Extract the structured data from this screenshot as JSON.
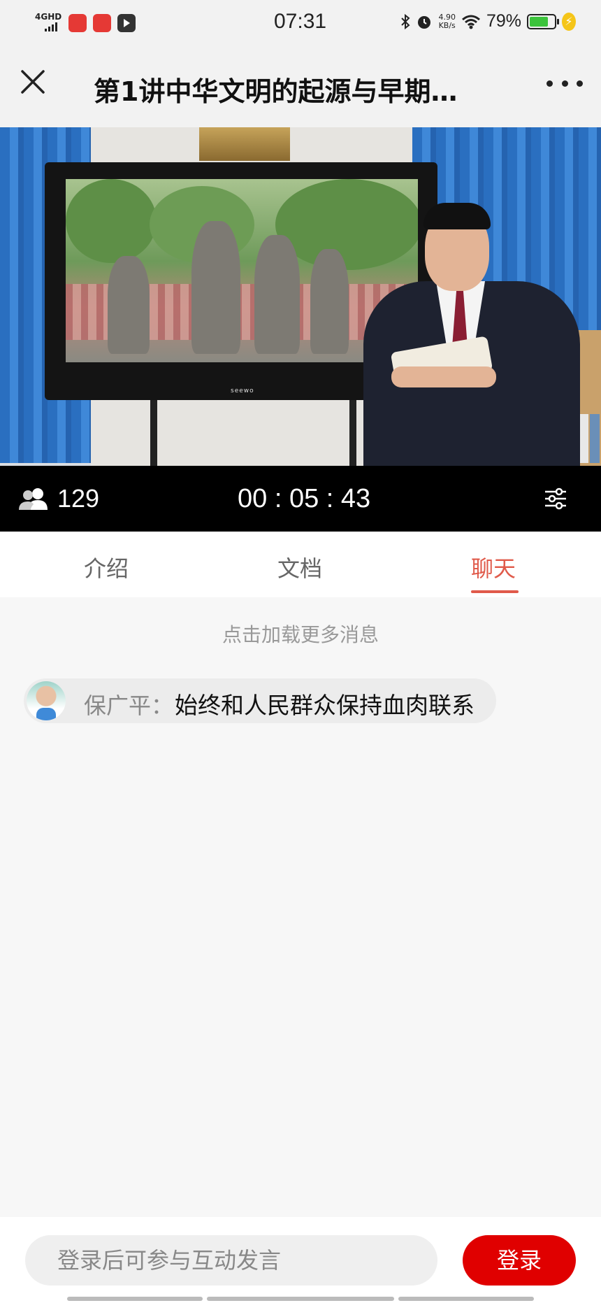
{
  "status_bar": {
    "network": "4GHD",
    "time": "07:31",
    "speed_value": "4.90",
    "speed_unit": "KB/s",
    "battery_percent": "79%",
    "battery_level": 0.79,
    "app_icon_colors": [
      "#e53935",
      "#e53935",
      "#333333"
    ]
  },
  "header": {
    "title": "第1讲中华文明的起源与早期…"
  },
  "video": {
    "viewer_count": "129",
    "elapsed_time": "00 : 05 : 43",
    "tv_brand": "seewo"
  },
  "tabs": [
    {
      "label": "介绍",
      "active": false
    },
    {
      "label": "文档",
      "active": false
    },
    {
      "label": "聊天",
      "active": true
    }
  ],
  "chat": {
    "load_more": "点击加载更多消息",
    "messages": [
      {
        "sender": "保广平",
        "separator": "：",
        "text": "始终和人民群众保持血肉联系"
      }
    ]
  },
  "footer": {
    "input_placeholder": "登录后可参与互动发言",
    "login_label": "登录"
  },
  "colors": {
    "accent": "#e05a4a",
    "login_button": "#e00000"
  }
}
